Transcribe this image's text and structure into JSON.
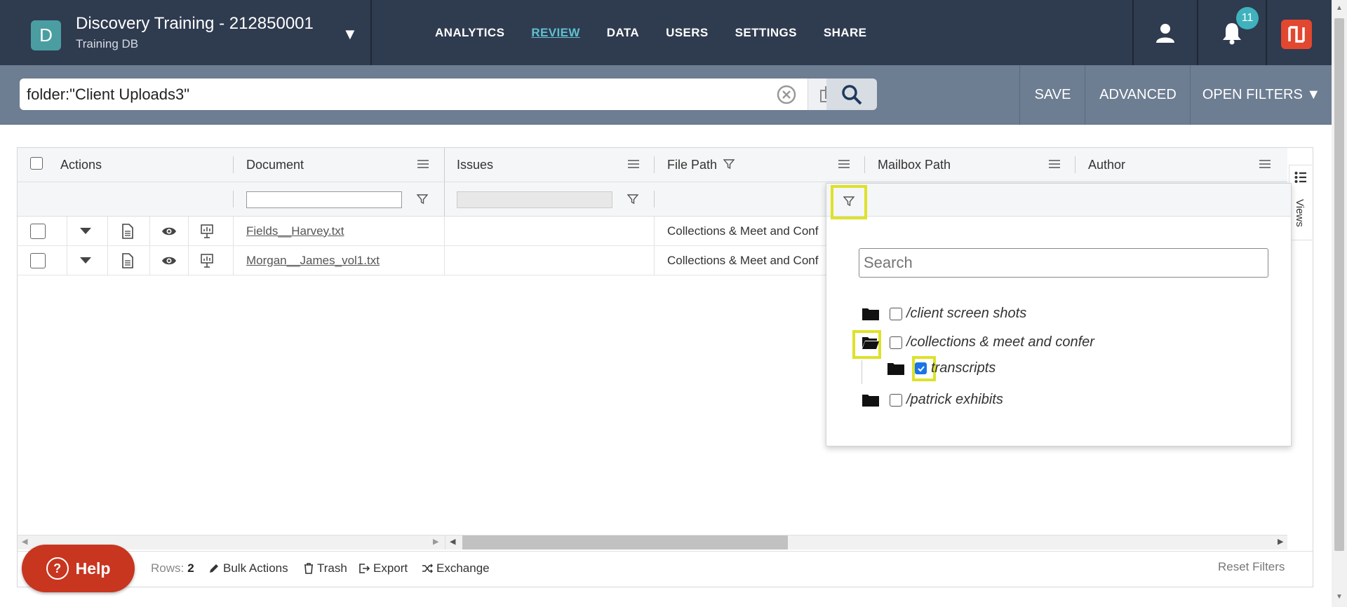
{
  "header": {
    "db_initial": "D",
    "db_title": "Discovery Training - 212850001",
    "db_subtitle": "Training DB",
    "nav": [
      "ANALYTICS",
      "REVIEW",
      "DATA",
      "USERS",
      "SETTINGS",
      "SHARE"
    ],
    "active_nav": "REVIEW",
    "notification_count": "11"
  },
  "search": {
    "query": "folder:\"Client Uploads3\"",
    "save_label": "SAVE",
    "advanced_label": "ADVANCED",
    "open_filters_label": "OPEN FILTERS ▼"
  },
  "grid": {
    "columns": [
      "Actions",
      "Document",
      "Issues",
      "File Path",
      "Mailbox Path",
      "Author"
    ],
    "rows": [
      {
        "document": "Fields__Harvey.txt",
        "file_path": "Collections & Meet and Conf"
      },
      {
        "document": "Morgan__James_vol1.txt",
        "file_path": "Collections & Meet and Conf"
      }
    ],
    "views_label": "Views"
  },
  "footer": {
    "rows_label": "Rows:",
    "rows_count": "2",
    "bulk_actions": "Bulk Actions",
    "trash": "Trash",
    "export": "Export",
    "exchange": "Exchange",
    "reset_filters": "Reset Filters",
    "help": "Help"
  },
  "filter_popup": {
    "search_placeholder": "Search",
    "tree": [
      {
        "label": "/client screen shots",
        "checked": false,
        "open": false
      },
      {
        "label": "/collections & meet and confer",
        "checked": false,
        "open": true
      },
      {
        "label": "transcripts",
        "checked": true,
        "open": false
      },
      {
        "label": "/patrick exhibits",
        "checked": false,
        "open": false
      }
    ]
  },
  "colors": {
    "topbar": "#2f3b4f",
    "searchbar": "#6d7d92",
    "accent": "#5fc0cf",
    "highlight": "#dde22a",
    "help_button": "#c8361f"
  }
}
